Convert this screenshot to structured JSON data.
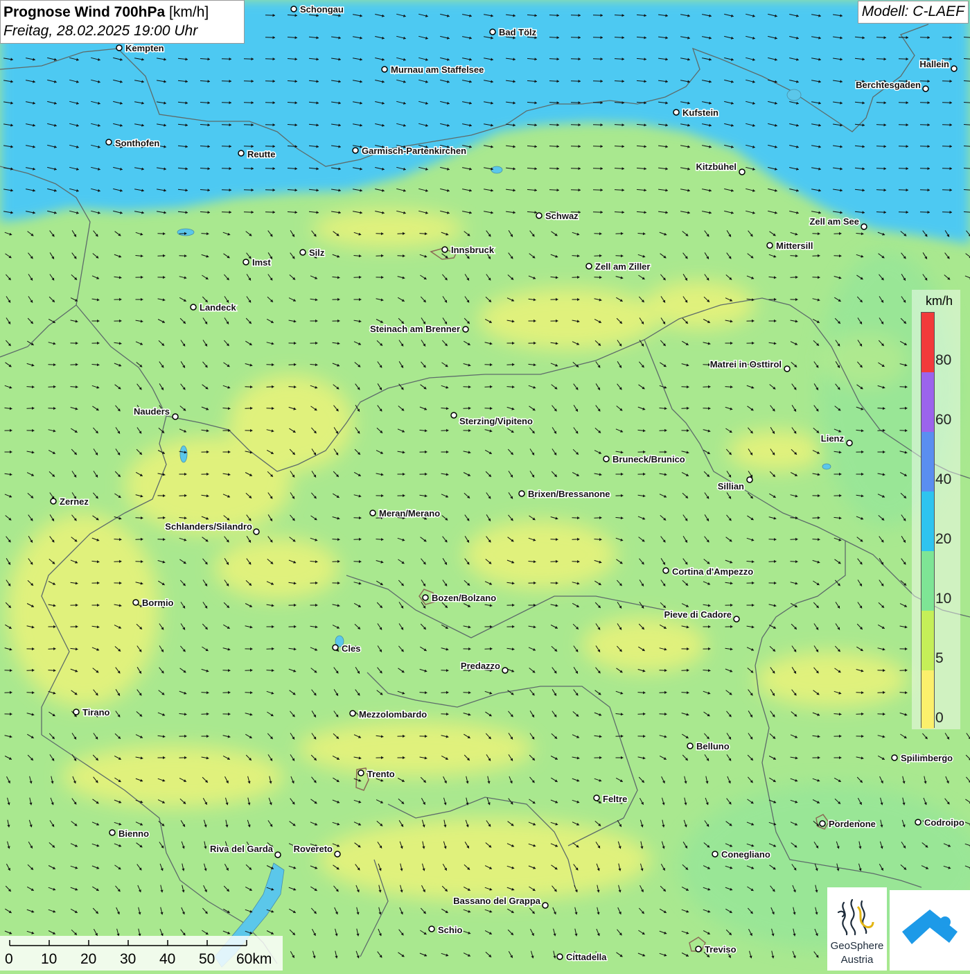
{
  "header": {
    "title_bold": "Prognose Wind 700hPa",
    "title_unit": "[km/h]",
    "subtitle": "Freitag, 28.02.2025 19:00 Uhr",
    "model": "Modell: C-LAEF"
  },
  "legend": {
    "unit": "km/h",
    "labels": [
      "80",
      "60",
      "40",
      "20",
      "10",
      "5",
      "0"
    ],
    "colors": [
      "#f23a3a",
      "#9b64ec",
      "#5a8ef0",
      "#2ec4ef",
      "#7ee595",
      "#c5ef58",
      "#fbf06c"
    ]
  },
  "scalebar": {
    "labels": [
      "0",
      "10",
      "20",
      "30",
      "40",
      "50",
      "60km"
    ]
  },
  "logos": {
    "geosphere_line1": "GeoSphere",
    "geosphere_line2": "Austria"
  },
  "map": {
    "colors": {
      "fast_band": "#4ec9f2",
      "moderate": "#a9e88f",
      "calm": "#e6f27a",
      "border": "#666666"
    },
    "cities": [
      "Schongau",
      "Bad Tölz",
      "Kempten",
      "Murnau am Staffelsee",
      "Hallein",
      "Berchtesgaden",
      "Kufstein",
      "Sonthofen",
      "Reutte",
      "Garmisch-Partenkirchen",
      "Kitzbühel",
      "Schwaz",
      "Zell am See",
      "Mittersill",
      "Imst",
      "Silz",
      "Innsbruck",
      "Zell am Ziller",
      "Landeck",
      "Steinach am Brenner",
      "Matrei in Osttirol",
      "Nauders",
      "Sterzing/Vipiteno",
      "Lienz",
      "Bruneck/Brunico",
      "Sillian",
      "Brixen/Bressanone",
      "Zernez",
      "Meran/Merano",
      "Schlanders/Silandro",
      "Cortina d'Ampezzo",
      "Bozen/Bolzano",
      "Bormio",
      "Pieve di Cadore",
      "Cles",
      "Predazzo",
      "Tirano",
      "Mezzolombardo",
      "Belluno",
      "Spilimbergo",
      "Trento",
      "Feltre",
      "Bienno",
      "Pordenone",
      "Codroipo",
      "Riva del Garda",
      "Rovereto",
      "Conegliano",
      "Bassano del Grappa",
      "Schio",
      "Treviso",
      "Cittadella"
    ]
  }
}
